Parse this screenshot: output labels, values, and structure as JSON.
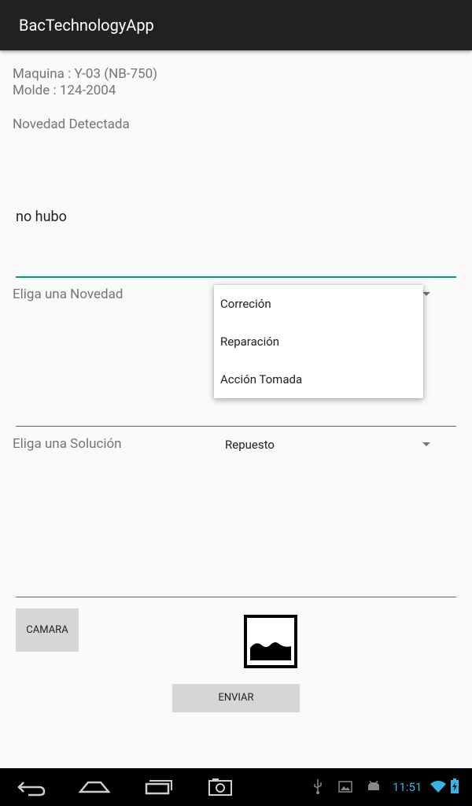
{
  "app": {
    "title": "BacTechnologyApp"
  },
  "info": {
    "maquina": "Maquina : Y-03 (NB-750)",
    "molde": "Molde : 124-2004",
    "novedad_detectada_label": "Novedad Detectada"
  },
  "novedad_input": {
    "value": "no hubo"
  },
  "novedad_spinner": {
    "label": "Eliga una Novedad",
    "options": [
      "Correción",
      "Reparación",
      "Acción Tomada"
    ]
  },
  "solucion_spinner": {
    "label": "Eliga una Solución",
    "selected": "Repuesto"
  },
  "buttons": {
    "camara": "CAMARA",
    "enviar": "ENVIAR"
  },
  "image_preview": {
    "icon": "image-placeholder-icon"
  },
  "status_bar": {
    "time": "11:51",
    "icons": [
      "usb-icon",
      "image-icon",
      "android-debug-icon",
      "wifi-icon",
      "battery-charging-icon"
    ]
  },
  "navigation": {
    "buttons": [
      "back-icon",
      "home-icon",
      "recent-apps-icon",
      "screenshot-icon"
    ]
  },
  "colors": {
    "appbar": "#212121",
    "accent": "#009688",
    "clock": "#33b5e5",
    "background": "#fafafa"
  }
}
